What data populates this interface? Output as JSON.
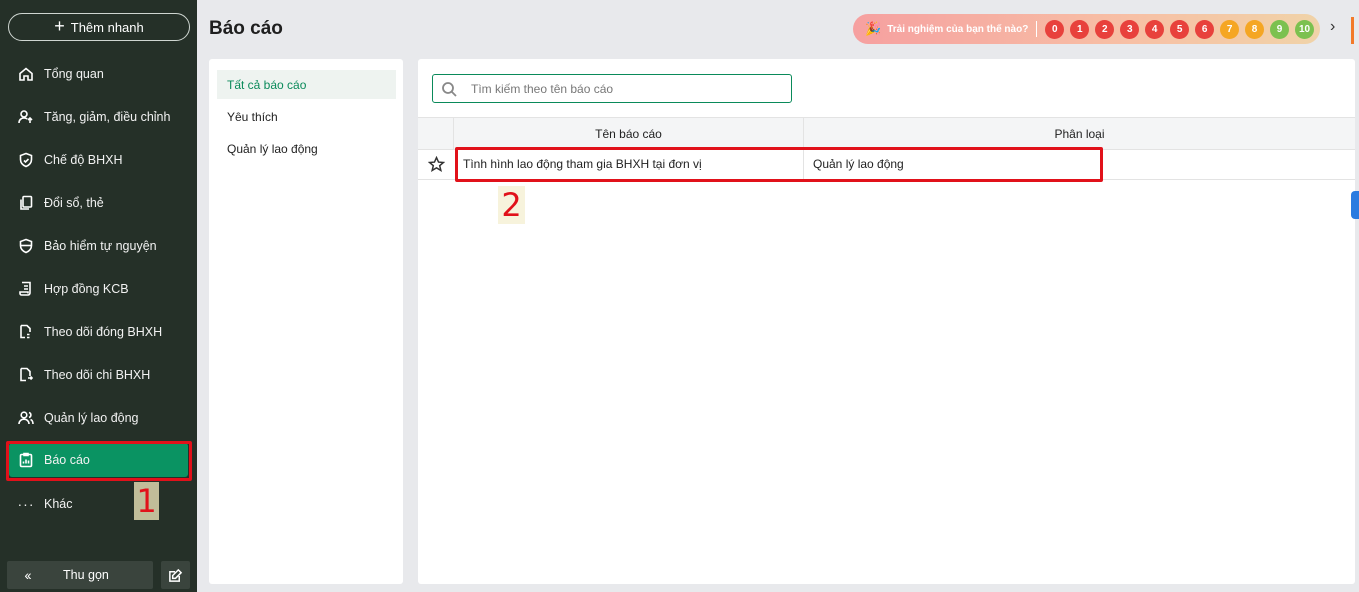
{
  "sidebar": {
    "quick_add_label": "Thêm nhanh",
    "items": [
      {
        "label": "Tổng quan",
        "icon": "home-icon"
      },
      {
        "label": "Tăng, giảm, điều chỉnh",
        "icon": "user-arrow-icon"
      },
      {
        "label": "Chế độ BHXH",
        "icon": "shield-heart-icon"
      },
      {
        "label": "Đổi sổ, thẻ",
        "icon": "documents-icon"
      },
      {
        "label": "Bảo hiểm tự nguyện",
        "icon": "shield-check-icon"
      },
      {
        "label": "Hợp đồng KCB",
        "icon": "contract-icon"
      },
      {
        "label": "Theo dõi đóng BHXH",
        "icon": "c12-doc-icon"
      },
      {
        "label": "Theo dõi chi BHXH",
        "icon": "payment-doc-icon"
      },
      {
        "label": "Quản lý lao động",
        "icon": "users-icon"
      },
      {
        "label": "Báo cáo",
        "icon": "clipboard-chart-icon",
        "active": true
      },
      {
        "label": "Khác",
        "icon": "more-icon"
      }
    ],
    "collapse_label": "Thu gọn",
    "annotation_1": "1"
  },
  "header": {
    "title": "Báo cáo",
    "rating_question": "Trải nghiệm của bạn thế nào?",
    "scores": [
      "0",
      "1",
      "2",
      "3",
      "4",
      "5",
      "6",
      "7",
      "8",
      "9",
      "10"
    ],
    "score_colors": [
      "#e8413c",
      "#e8413c",
      "#e8413c",
      "#e8413c",
      "#e8413c",
      "#e8413c",
      "#e8413c",
      "#f5a623",
      "#f5a623",
      "#7cc14f",
      "#7cc14f"
    ]
  },
  "categories": {
    "items": [
      {
        "label": "Tất cả báo cáo",
        "active": true
      },
      {
        "label": "Yêu thích"
      },
      {
        "label": "Quản lý lao động"
      }
    ]
  },
  "main": {
    "search_placeholder": "Tìm kiếm theo tên báo cáo",
    "columns": [
      "Tên báo cáo",
      "Phân loại"
    ],
    "rows": [
      {
        "name": "Tình hình lao động tham gia BHXH tại đơn vị",
        "category": "Quản lý lao động"
      }
    ],
    "annotation_2": "2"
  },
  "colors": {
    "sidebar_bg": "#253028",
    "accent_green": "#0a9362",
    "highlight_red": "#e1111a"
  }
}
